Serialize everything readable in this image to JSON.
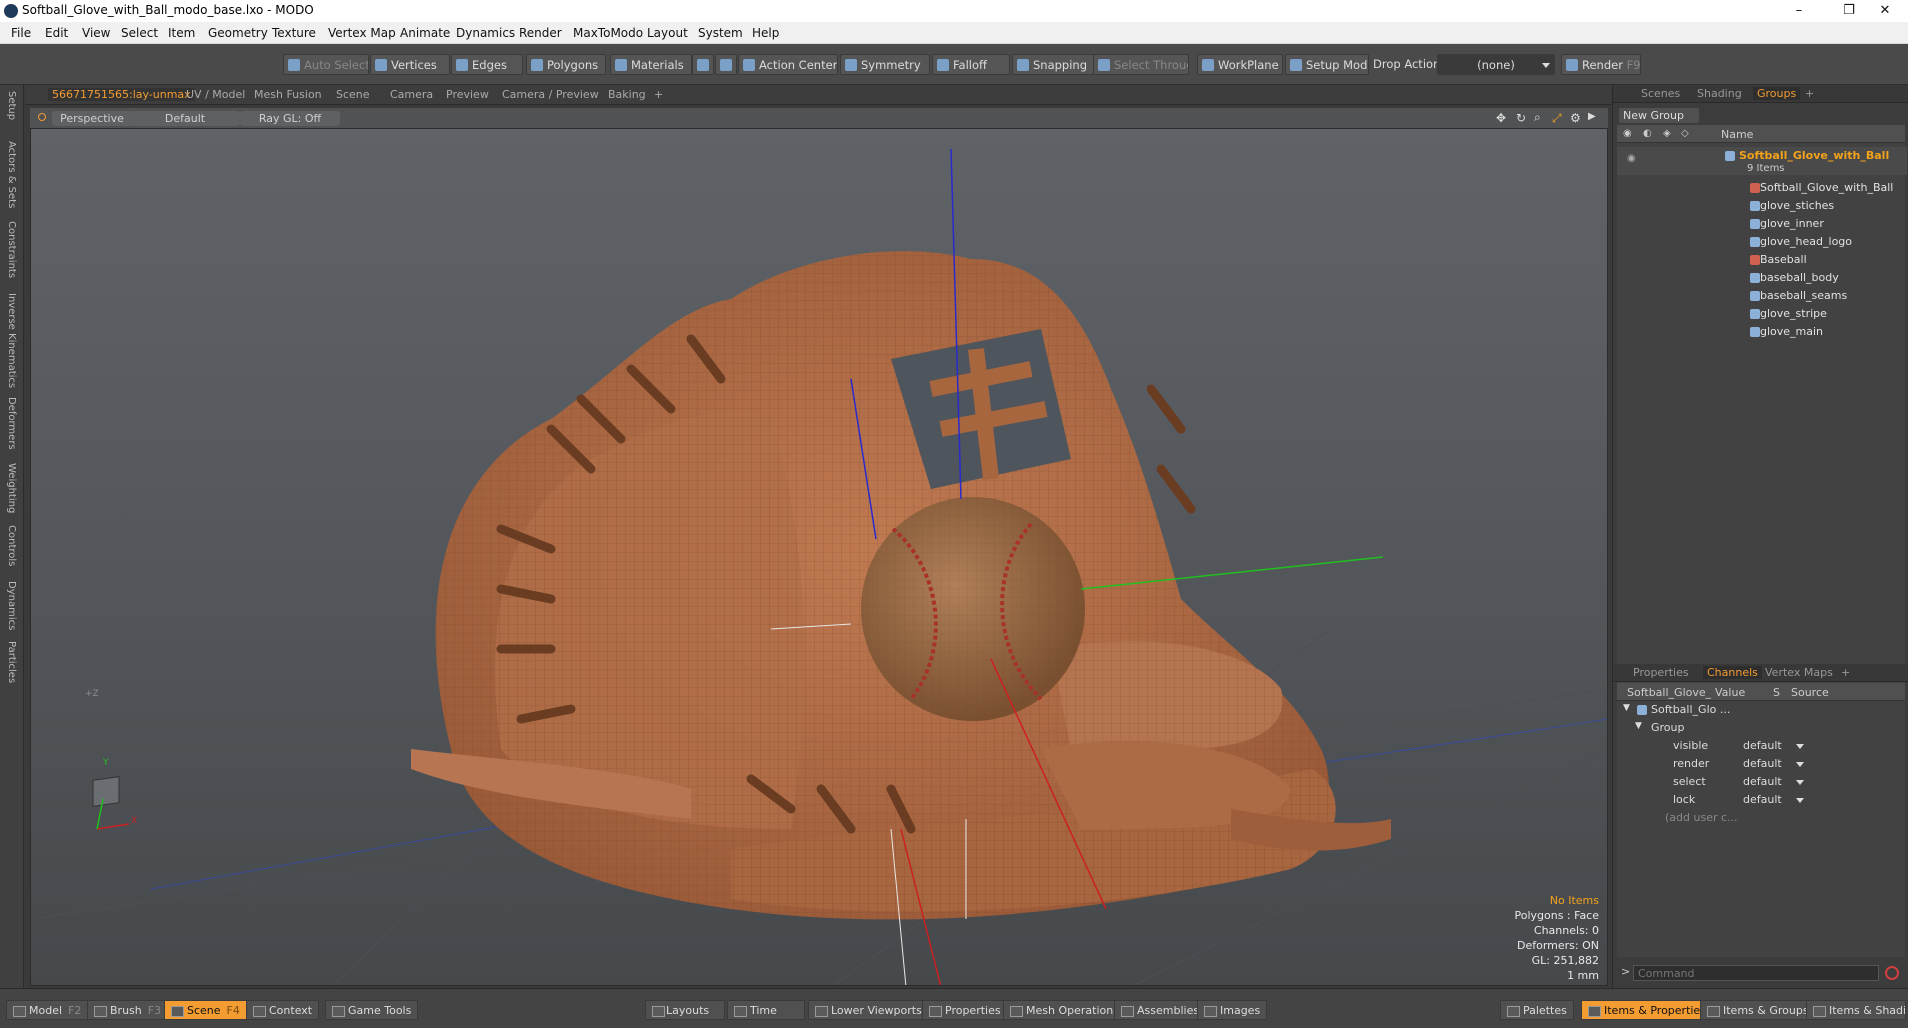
{
  "window": {
    "title": "Softball_Glove_with_Ball_modo_base.lxo - MODO",
    "minimize": "–",
    "maximize": "❐",
    "close": "✕"
  },
  "menu": [
    "File",
    "Edit",
    "View",
    "Select",
    "Item",
    "Geometry",
    "Texture",
    "Vertex Map",
    "Animate",
    "Dynamics",
    "Render",
    "MaxToModo",
    "Layout",
    "System",
    "Help"
  ],
  "toolbar": {
    "auto_select": "Auto Select",
    "vertices": "Vertices",
    "edges": "Edges",
    "polygons": "Polygons",
    "materials": "Materials",
    "action_center": "Action Center",
    "symmetry": "Symmetry",
    "falloff": "Falloff",
    "snapping": "Snapping",
    "select_through": "Select Through",
    "workplane": "WorkPlane",
    "setup_mode": "Setup Mode",
    "drop_action": "Drop Action",
    "drop_value": "(none)",
    "render": "Render",
    "render_key": "F9"
  },
  "left_tabs": [
    "Setup",
    "Actors & Sets",
    "Constraints",
    "Inverse Kinematics",
    "Deformers",
    "Weighting",
    "Controls",
    "Dynamics",
    "Particles"
  ],
  "viewport_tabs": [
    "56671751565:lay-unmax",
    "UV / Model",
    "Mesh Fusion",
    "Scene",
    "Camera",
    "Preview",
    "Camera / Preview",
    "Baking",
    "+"
  ],
  "viewport_bar": {
    "view": "Perspective",
    "shading": "Default",
    "raygl": "Ray GL: Off"
  },
  "viewport_info": {
    "items": "No Items",
    "polygons": "Polygons : Face",
    "channels": "Channels: 0",
    "deformers": "Deformers: ON",
    "gl": "GL: 251,882",
    "scale": "1 mm"
  },
  "axis_labels": {
    "y": "Y",
    "x": "X",
    "z": "+Z"
  },
  "right_tabs": [
    "Scenes",
    "Shading",
    "Groups",
    "+"
  ],
  "groups": {
    "new_group": "New Group",
    "name_header": "Name",
    "root": "Softball_Glove_with_Ball",
    "count": "9 Items",
    "items": [
      "Softball_Glove_with_Ball",
      "glove_stiches",
      "glove_inner",
      "glove_head_logo",
      "Baseball",
      "baseball_body",
      "baseball_seams",
      "glove_stripe",
      "glove_main"
    ]
  },
  "prop_tabs": [
    "Properties",
    "Channels",
    "Vertex Maps",
    "+"
  ],
  "channels": {
    "headers": [
      "Softball_Glove_wi...",
      "Value",
      "S",
      "Source"
    ],
    "tree_root": "Softball_Glo ...",
    "group": "Group",
    "rows": [
      {
        "k": "visible",
        "v": "default"
      },
      {
        "k": "render",
        "v": "default"
      },
      {
        "k": "select",
        "v": "default"
      },
      {
        "k": "lock",
        "v": "default"
      }
    ],
    "add_user": "(add user c..."
  },
  "command_placeholder": "Command",
  "status": {
    "left": [
      {
        "label": "Model",
        "key": "F2"
      },
      {
        "label": "Brush",
        "key": "F3"
      },
      {
        "label": "Scene",
        "key": "F4"
      },
      {
        "label": "Context",
        "key": ""
      },
      {
        "label": "Game Tools",
        "key": ""
      }
    ],
    "mid": [
      "Layouts",
      "Time",
      "Lower Viewports",
      "Properties",
      "Mesh Operations",
      "Assemblies",
      "Images"
    ],
    "right": [
      "Palettes",
      "Items & Properties",
      "Items & Groups",
      "Items & Shading"
    ]
  }
}
